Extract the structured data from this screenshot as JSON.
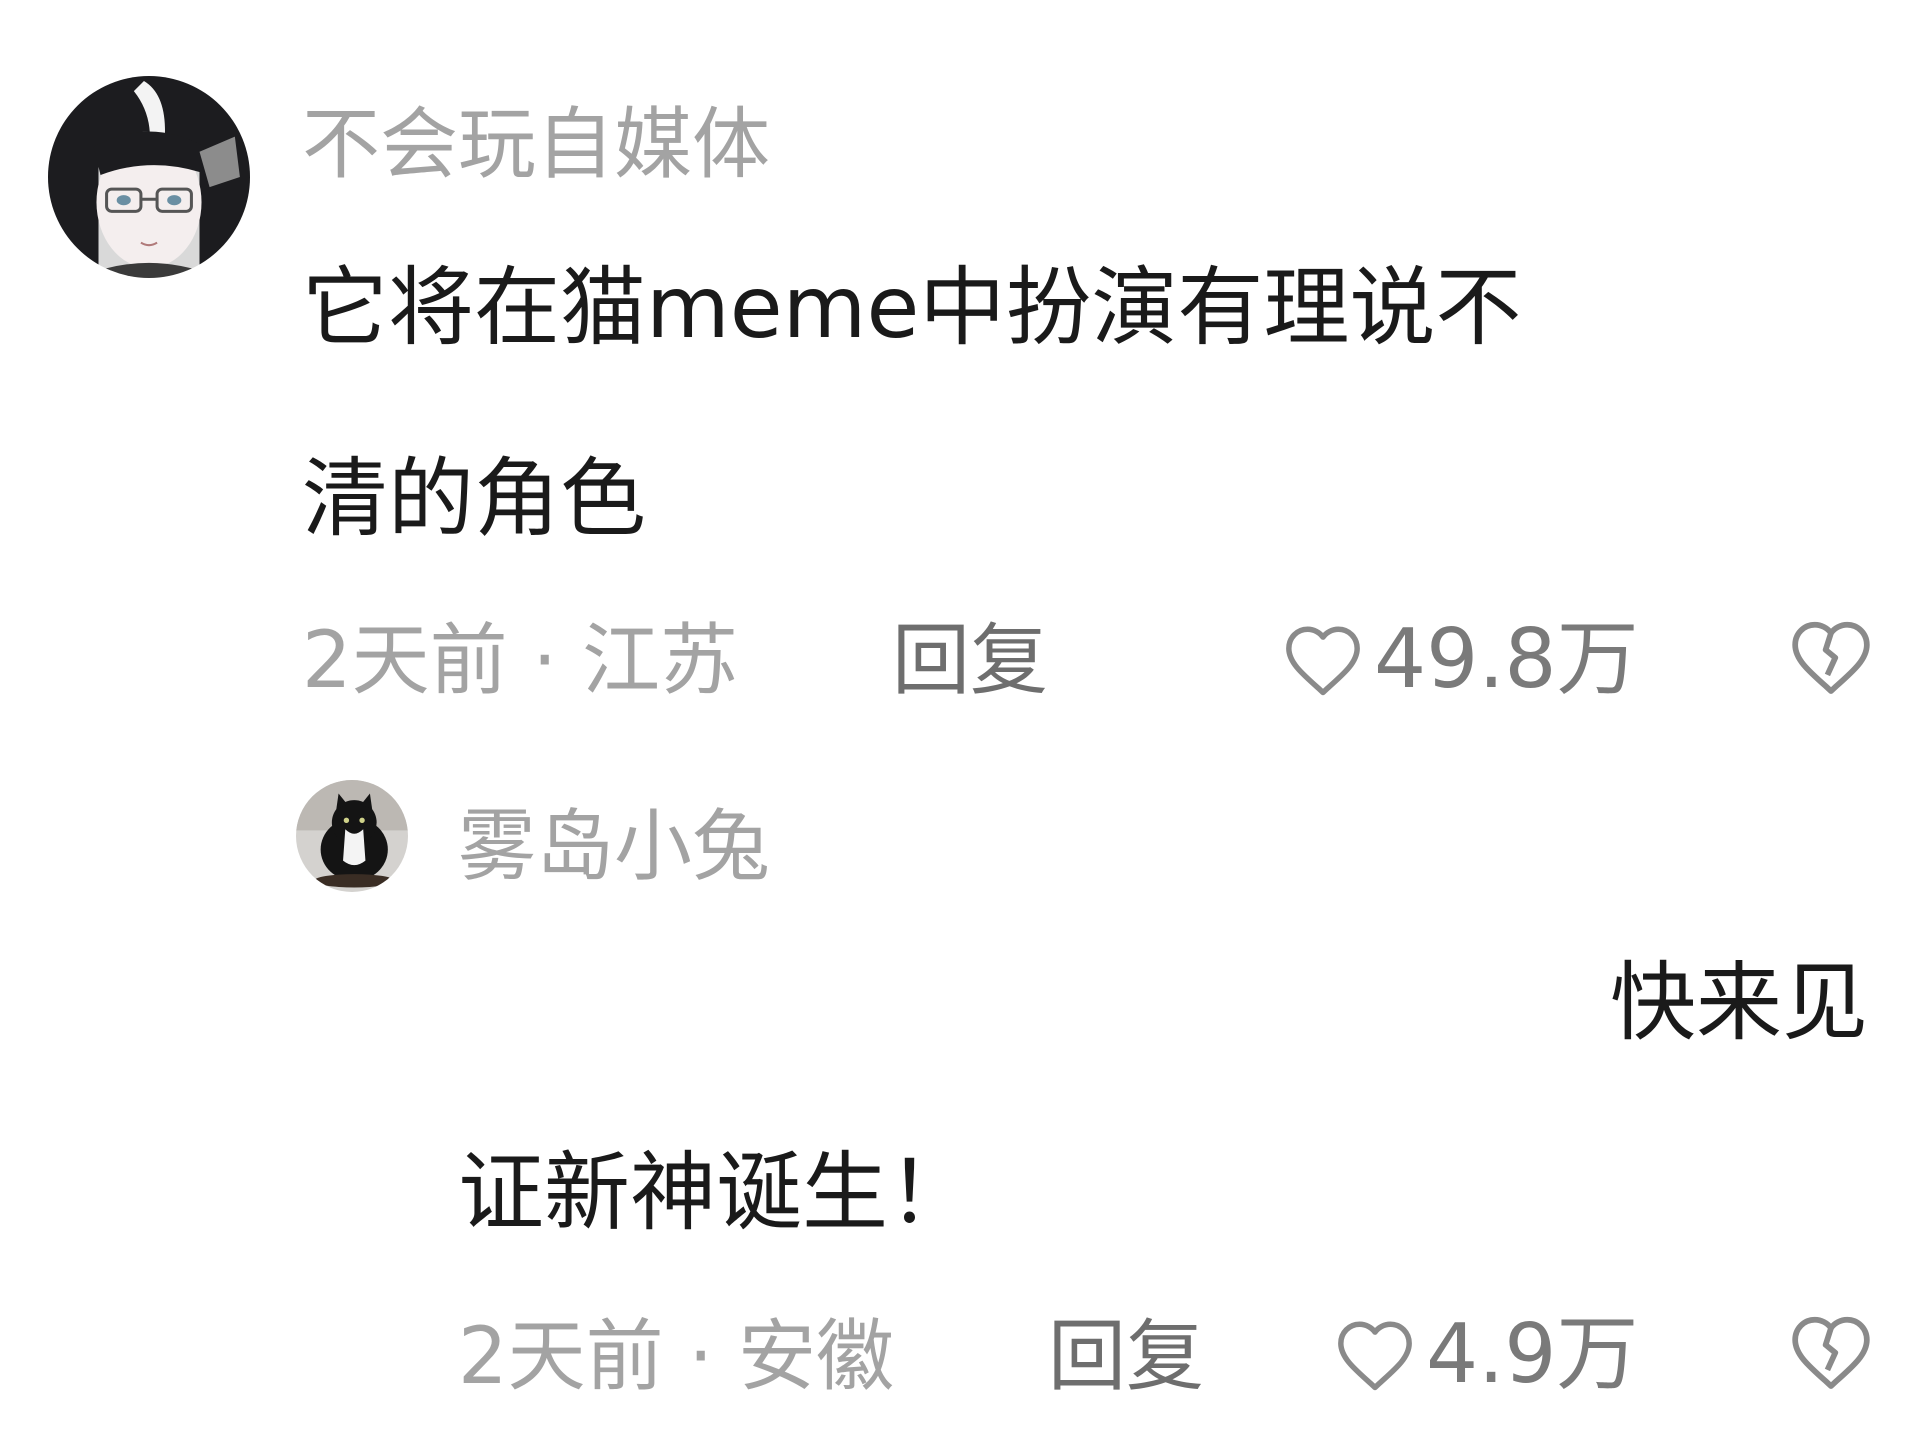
{
  "comments": [
    {
      "username": "不会玩自媒体",
      "text_lines": [
        "它将在猫meme中扮演有理说不",
        "清的角色"
      ],
      "time_location": "2天前 · 江苏",
      "reply_label": "回复",
      "likes": "49.8万",
      "avatar_icon": "anime-girl-glasses-avatar",
      "like_icon": "heart-outline-icon",
      "dislike_icon": "broken-heart-icon"
    },
    {
      "username": "雾岛小兔",
      "text_lines": [
        "快来见",
        "证新神诞生！"
      ],
      "time_location": "2天前 · 安徽",
      "reply_label": "回复",
      "likes": "4.9万",
      "avatar_icon": "black-white-cat-avatar",
      "like_icon": "heart-outline-icon",
      "dislike_icon": "broken-heart-icon"
    }
  ],
  "colors": {
    "text_primary": "#1a1a1a",
    "text_secondary": "#a3a3a3",
    "reply": "#6e6e6e",
    "icon": "#8a8a8a",
    "background": "#ffffff"
  }
}
